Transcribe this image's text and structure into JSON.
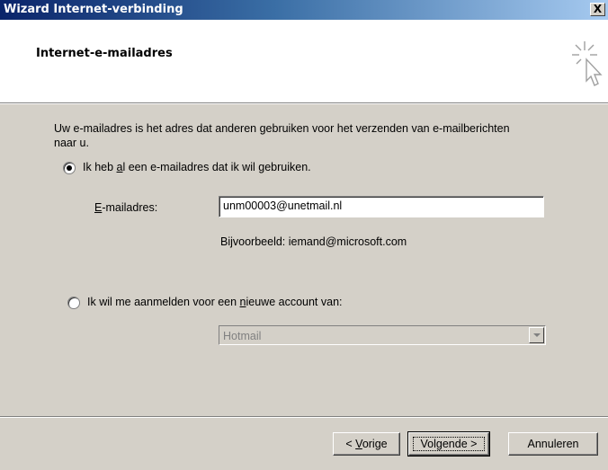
{
  "window": {
    "title": "Wizard Internet-verbinding",
    "close_label": "X"
  },
  "header": {
    "title": "Internet-e-mailadres",
    "icon": "wizard-cursor-sparkle-icon"
  },
  "content": {
    "description": "Uw e-mailadres is het adres dat anderen gebruiken voor het verzenden van e-mailberichten naar u.",
    "option_existing": {
      "label_before": "Ik heb ",
      "mnemonic": "a",
      "label_after": "l een e-mailadres dat ik wil gebruiken.",
      "selected": true
    },
    "email_field": {
      "label_mnemonic": "E",
      "label_rest": "-mailadres:",
      "value": "unm00003@unetmail.nl"
    },
    "example_text": "Bijvoorbeeld: iemand@microsoft.com",
    "option_new": {
      "label_before": "Ik wil me aanmelden voor een ",
      "mnemonic": "n",
      "label_after": "ieuwe account van:",
      "selected": false
    },
    "provider_select": {
      "value": "Hotmail",
      "disabled": true
    }
  },
  "buttons": {
    "back_prefix": "< ",
    "back_mnemonic": "V",
    "back_rest": "orige",
    "next": "Volgende >",
    "cancel": "Annuleren"
  }
}
